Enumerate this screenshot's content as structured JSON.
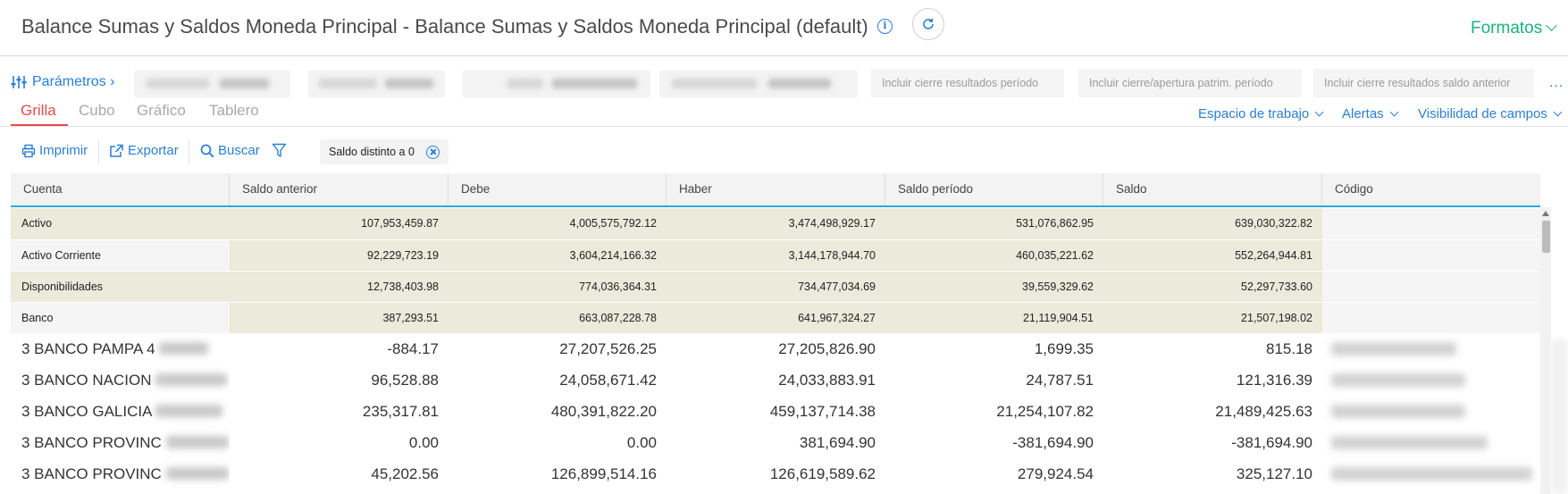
{
  "header": {
    "title": "Balance Sumas y Saldos Moneda Principal - Balance Sumas y Saldos Moneda Principal (default)",
    "info_glyph": "i",
    "formatos_label": "Formatos"
  },
  "params": {
    "link_label": "Parámetros ›",
    "chips": [
      "Incluir cierre resultados período",
      "Incluir cierre/apertura patrim. período",
      "Incluir cierre resultados saldo anterior"
    ],
    "more_label": "..."
  },
  "tabs": [
    "Grilla",
    "Cubo",
    "Gráfico",
    "Tablero"
  ],
  "topright": {
    "workspace": "Espacio de trabajo",
    "alerts": "Alertas",
    "visibility": "Visibilidad de campos"
  },
  "toolbar": {
    "print": "Imprimir",
    "export": "Exportar",
    "search": "Buscar",
    "filter_chip": "Saldo distinto a 0"
  },
  "grid": {
    "columns": [
      "Cuenta",
      "Saldo anterior",
      "Debe",
      "Haber",
      "Saldo período",
      "Saldo",
      "Código"
    ],
    "rows": [
      {
        "cuenta": "Activo",
        "saldo_anterior": "107,953,459.87",
        "debe": "4,005,575,792.12",
        "haber": "3,474,498,929.17",
        "saldo_periodo": "531,076,862.95",
        "saldo": "639,030,322.82",
        "codigo": ""
      },
      {
        "cuenta": "Activo Corriente",
        "saldo_anterior": "92,229,723.19",
        "debe": "3,604,214,166.32",
        "haber": "3,144,178,944.70",
        "saldo_periodo": "460,035,221.62",
        "saldo": "552,264,944.81",
        "codigo": ""
      },
      {
        "cuenta": "Disponibilidades",
        "saldo_anterior": "12,738,403.98",
        "debe": "774,036,364.31",
        "haber": "734,477,034.69",
        "saldo_periodo": "39,559,329.62",
        "saldo": "52,297,733.60",
        "codigo": ""
      },
      {
        "cuenta": "Banco",
        "saldo_anterior": "387,293.51",
        "debe": "663,087,228.78",
        "haber": "641,967,324.27",
        "saldo_periodo": "21,119,904.51",
        "saldo": "21,507,198.02",
        "codigo": ""
      },
      {
        "cuenta": "3 BANCO PAMPA 4",
        "saldo_anterior": "-884.17",
        "debe": "27,207,526.25",
        "haber": "27,205,826.90",
        "saldo_periodo": "1,699.35",
        "saldo": "815.18",
        "codigo": ""
      },
      {
        "cuenta": "3 BANCO NACION",
        "saldo_anterior": "96,528.88",
        "debe": "24,058,671.42",
        "haber": "24,033,883.91",
        "saldo_periodo": "24,787.51",
        "saldo": "121,316.39",
        "codigo": ""
      },
      {
        "cuenta": "3 BANCO GALICIA",
        "saldo_anterior": "235,317.81",
        "debe": "480,391,822.20",
        "haber": "459,137,714.38",
        "saldo_periodo": "21,254,107.82",
        "saldo": "21,489,425.63",
        "codigo": ""
      },
      {
        "cuenta": "3 BANCO PROVINC",
        "saldo_anterior": "0.00",
        "debe": "0.00",
        "haber": "381,694.90",
        "saldo_periodo": "-381,694.90",
        "saldo": "-381,694.90",
        "codigo": ""
      },
      {
        "cuenta": "3 BANCO PROVINC",
        "saldo_anterior": "45,202.56",
        "debe": "126,899,514.16",
        "haber": "126,619,589.62",
        "saldo_periodo": "279,924.54",
        "saldo": "325,127.10",
        "codigo": ""
      }
    ]
  },
  "colors": {
    "accent_blue": "#2a7fd4",
    "formatos_green": "#1bb37d",
    "active_tab_red": "#e84a4a",
    "total_row_bg": "#ebeadb"
  }
}
